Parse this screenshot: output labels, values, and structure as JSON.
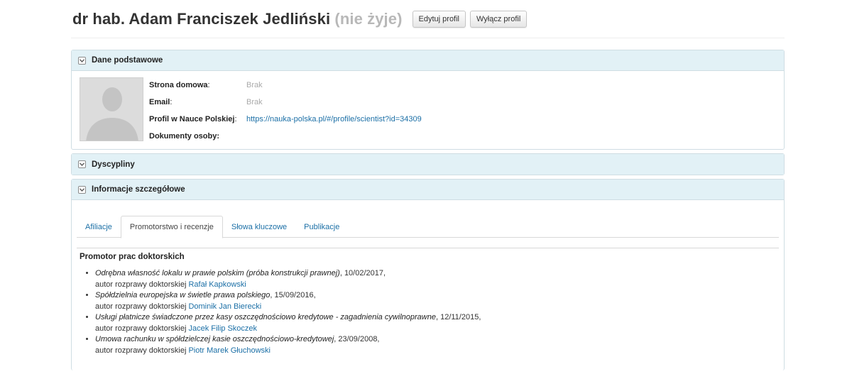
{
  "header": {
    "name": "dr hab. Adam Franciszek Jedliński",
    "status": "(nie żyje)",
    "edit_button": "Edytuj profil",
    "disable_button": "Wyłącz profil"
  },
  "panels": {
    "basic": {
      "title": "Dane podstawowe",
      "toggle_icon": "chevron-down-icon"
    },
    "disciplines": {
      "title": "Dyscypliny",
      "toggle_icon": "chevron-down-icon"
    },
    "details": {
      "title": "Informacje szczegółowe",
      "toggle_icon": "chevron-down-icon"
    }
  },
  "basic_fields": [
    {
      "label": "Strona domowa",
      "suffix": ":",
      "value": "Brak"
    },
    {
      "label": "Email",
      "suffix": ":",
      "value": "Brak"
    },
    {
      "label": "Profil w Nauce Polskiej",
      "suffix": ":",
      "value": "https://nauka-polska.pl/#/profile/scientist?id=34309"
    },
    {
      "label": "Dokumenty osoby",
      "suffix": ":",
      "value": ""
    }
  ],
  "tabs": [
    {
      "label": "Afiliacje",
      "active": false
    },
    {
      "label": "Promotorstwo i recenzje",
      "active": true
    },
    {
      "label": "Słowa kluczowe",
      "active": false
    },
    {
      "label": "Publikacje",
      "active": false
    }
  ],
  "promotor": {
    "section_title": "Promotor prac doktorskich",
    "author_prefix": "autor rozprawy doktorskiej",
    "entries": [
      {
        "title": "Odrębna własność lokalu w prawie polskim (próba konstrukcji prawnej)",
        "date": ", 10/02/2017,",
        "author": "Rafał Kapkowski"
      },
      {
        "title": "Spółdzielnia europejska w świetle prawa polskiego",
        "date": ", 15/09/2016,",
        "author": "Dominik Jan Bierecki"
      },
      {
        "title": "Usługi płatnicze świadczone przez kasy oszczędnościowo kredytowe - zagadnienia cywilnoprawne",
        "date": ", 12/11/2015,",
        "author": "Jacek Filip Skoczek"
      },
      {
        "title": "Umowa rachunku w spółdzielczej kasie oszczędnościowo-kredytowej",
        "date": ", 23/09/2008,",
        "author": "Piotr Marek Głuchowski"
      }
    ]
  },
  "colors": {
    "panel_header_bg": "#e2f1f6",
    "link": "#1b6fa6",
    "muted": "#aaaaaa"
  }
}
